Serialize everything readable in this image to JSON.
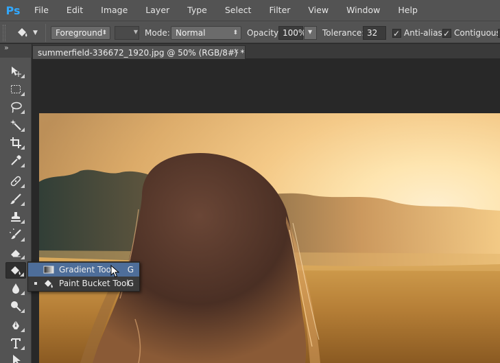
{
  "app": {
    "logo": "Ps"
  },
  "menu": [
    "File",
    "Edit",
    "Image",
    "Layer",
    "Type",
    "Select",
    "Filter",
    "View",
    "Window",
    "Help"
  ],
  "options": {
    "tool_icon": "paint-bucket-icon",
    "fill_source": "Foreground",
    "mode_label": "Mode:",
    "mode_value": "Normal",
    "opacity_label": "Opacity:",
    "opacity_value": "100%",
    "tolerance_label": "Tolerance:",
    "tolerance_value": "32",
    "antialias_label": "Anti-alias",
    "antialias_checked": true,
    "contiguous_label": "Contiguous",
    "contiguous_checked": true
  },
  "toolbox": {
    "collapse_glyph": "»",
    "tools": [
      {
        "name": "move-tool",
        "icon": "move-icon"
      },
      {
        "name": "marquee-tool",
        "icon": "rectangular-marquee-icon"
      },
      {
        "name": "lasso-tool",
        "icon": "lasso-icon"
      },
      {
        "name": "magic-wand-tool",
        "icon": "magic-wand-icon"
      },
      {
        "name": "crop-tool",
        "icon": "crop-icon"
      },
      {
        "name": "eyedropper-tool",
        "icon": "eyedropper-icon"
      },
      {
        "name": "healing-brush-tool",
        "icon": "bandage-icon"
      },
      {
        "name": "brush-tool",
        "icon": "brush-icon"
      },
      {
        "name": "clone-stamp-tool",
        "icon": "stamp-icon"
      },
      {
        "name": "history-brush-tool",
        "icon": "history-brush-icon"
      },
      {
        "name": "eraser-tool",
        "icon": "eraser-icon"
      },
      {
        "name": "paint-bucket-tool",
        "icon": "paint-bucket-icon",
        "active": true
      },
      {
        "name": "blur-tool",
        "icon": "drop-icon"
      },
      {
        "name": "dodge-tool",
        "icon": "dodge-icon"
      },
      {
        "name": "pen-tool",
        "icon": "pen-icon"
      },
      {
        "name": "type-tool",
        "icon": "type-icon"
      },
      {
        "name": "path-selection-tool",
        "icon": "arrow-icon"
      }
    ]
  },
  "document": {
    "tab_title": "summerfield-336672_1920.jpg @ 50% (RGB/8#) *",
    "close_glyph": "×"
  },
  "flyout": {
    "items": [
      {
        "label": "Gradient Tool",
        "shortcut": "G",
        "icon": "gradient-icon",
        "highlighted": true,
        "selected": false
      },
      {
        "label": "Paint Bucket Tool",
        "shortcut": "G",
        "icon": "paint-bucket-icon",
        "highlighted": false,
        "selected": true
      }
    ]
  },
  "colors": {
    "chrome": "#535353",
    "canvas_bg": "#282828",
    "highlight": "#4e6e9a",
    "logo": "#31a8ff"
  }
}
